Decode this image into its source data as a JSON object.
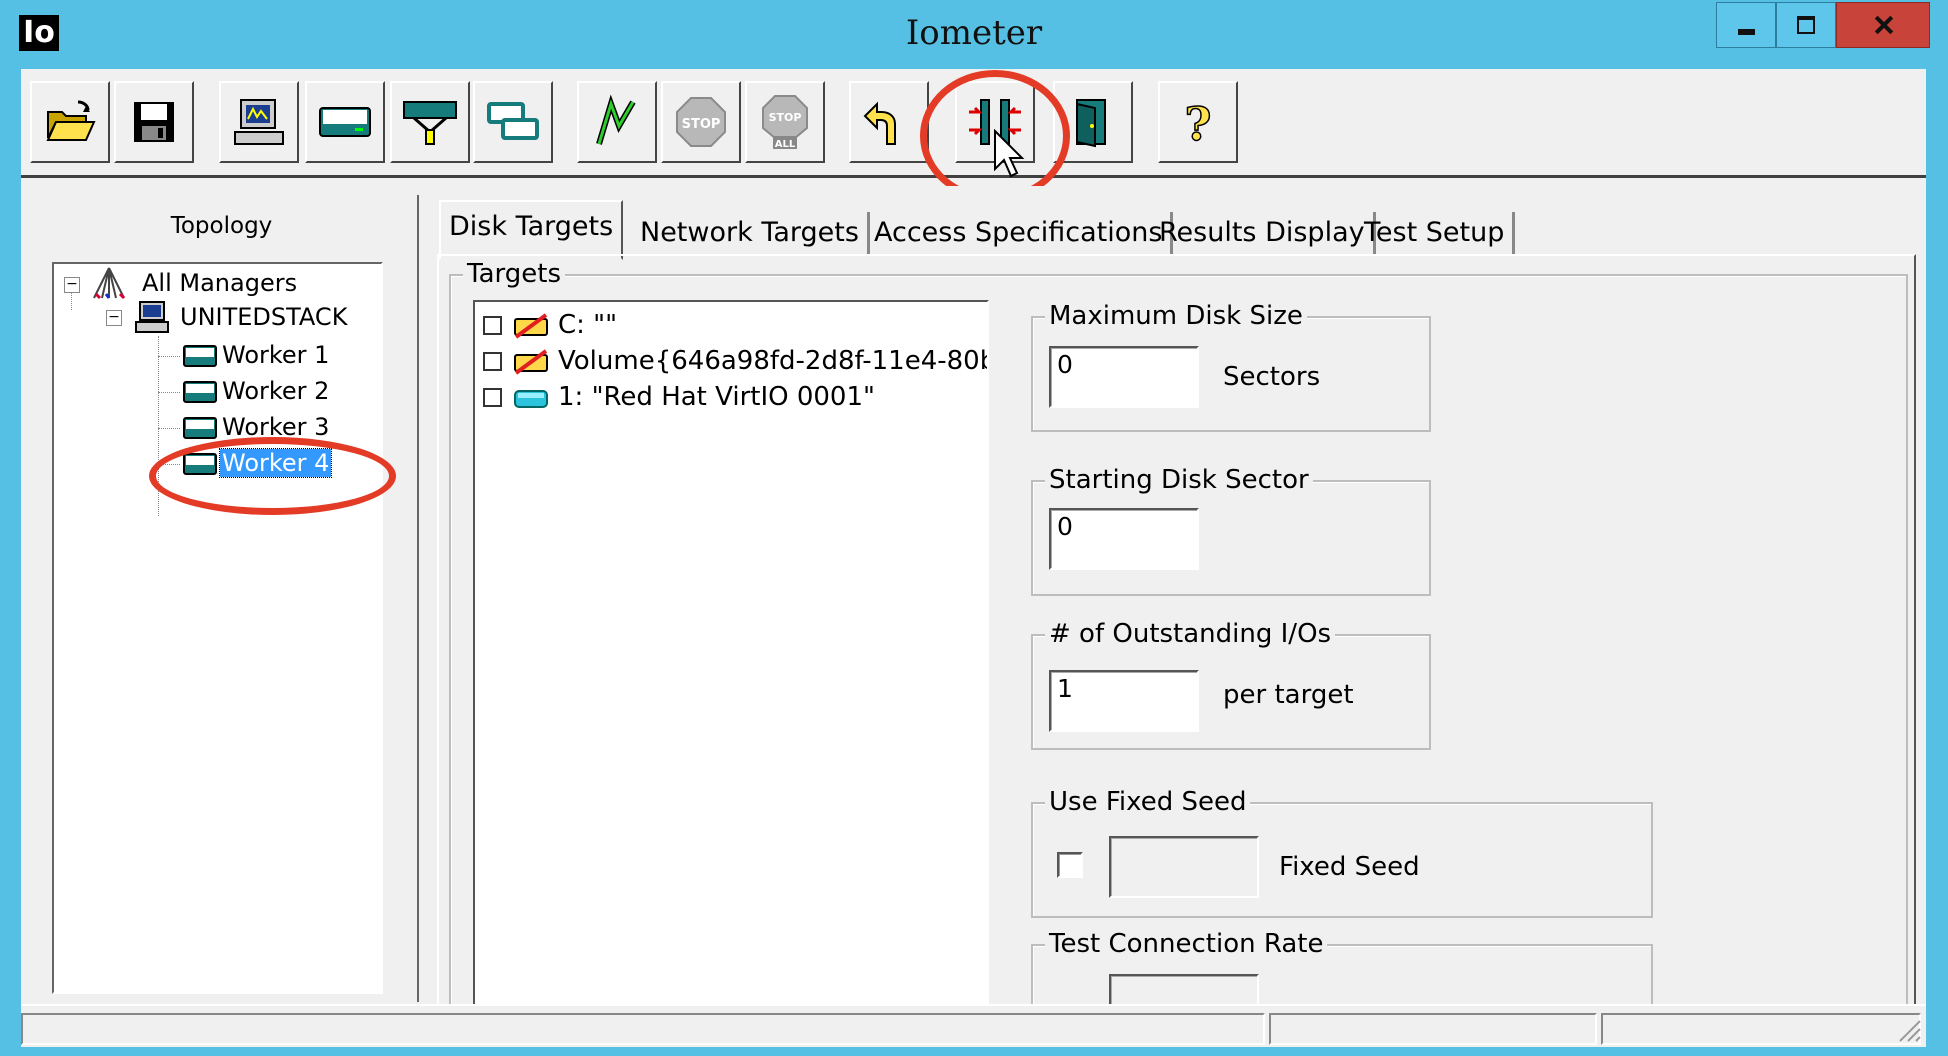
{
  "window": {
    "app_icon_text": "Io",
    "title": "Iometer",
    "controls": [
      "minimize",
      "maximize",
      "close"
    ]
  },
  "toolbar": {
    "buttons": [
      {
        "name": "open-config",
        "icon": "folder-open-icon"
      },
      {
        "name": "save-config",
        "icon": "floppy-disk-icon"
      },
      {
        "name": "start-new-manager",
        "icon": "computer-icon"
      },
      {
        "name": "start-disk-worker",
        "icon": "disk-worker-icon"
      },
      {
        "name": "start-network-worker",
        "icon": "network-worker-icon"
      },
      {
        "name": "duplicate-worker",
        "icon": "duplicate-worker-icon"
      },
      {
        "name": "start-tests",
        "icon": "green-flag-icon"
      },
      {
        "name": "stop",
        "icon": "stop-sign-icon",
        "label": "STOP"
      },
      {
        "name": "stop-all",
        "icon": "stop-all-sign-icon",
        "label": "STOP ALL"
      },
      {
        "name": "reset-workers",
        "icon": "reset-arrow-icon"
      },
      {
        "name": "disconnect-worker",
        "icon": "disconnect-worker-icon"
      },
      {
        "name": "exit",
        "icon": "exit-door-icon"
      },
      {
        "name": "about",
        "icon": "question-mark-icon",
        "label": "?"
      }
    ]
  },
  "topology": {
    "label": "Topology",
    "root": "All Managers",
    "manager": "UNITEDSTACK",
    "workers": [
      "Worker 1",
      "Worker 2",
      "Worker 3",
      "Worker 4"
    ],
    "selected": "Worker 4"
  },
  "tabs": [
    {
      "label": "Disk Targets",
      "active": true
    },
    {
      "label": "Network Targets",
      "active": false
    },
    {
      "label": "Access Specifications",
      "active": false
    },
    {
      "label": "Results Display",
      "active": false
    },
    {
      "label": "Test Setup",
      "active": false
    }
  ],
  "disk_targets": {
    "targets_label": "Targets",
    "targets": [
      {
        "label": "C: \"\"",
        "icon": "unavailable-drive-icon",
        "checked": false
      },
      {
        "label": "Volume{646a98fd-2d8f-11e4-80b",
        "icon": "unavailable-drive-icon",
        "checked": false
      },
      {
        "label": "1: \"Red Hat VirtIO 0001\"",
        "icon": "physical-disk-icon",
        "checked": false
      }
    ],
    "max_disk_size": {
      "label": "Maximum Disk Size",
      "value": "0",
      "unit": "Sectors"
    },
    "starting_disk_sector": {
      "label": "Starting Disk Sector",
      "value": "0"
    },
    "outstanding_ios": {
      "label": "# of Outstanding I/Os",
      "value": "1",
      "unit": "per target"
    },
    "fixed_seed": {
      "label": "Use Fixed Seed",
      "checked": false,
      "value": "",
      "field_label": "Fixed Seed"
    },
    "test_connection_rate": {
      "label": "Test Connection Rate"
    }
  },
  "colors": {
    "window_frame": "#56c0e4",
    "highlight_annotation": "#e43b26",
    "selection": "#3399ff"
  }
}
